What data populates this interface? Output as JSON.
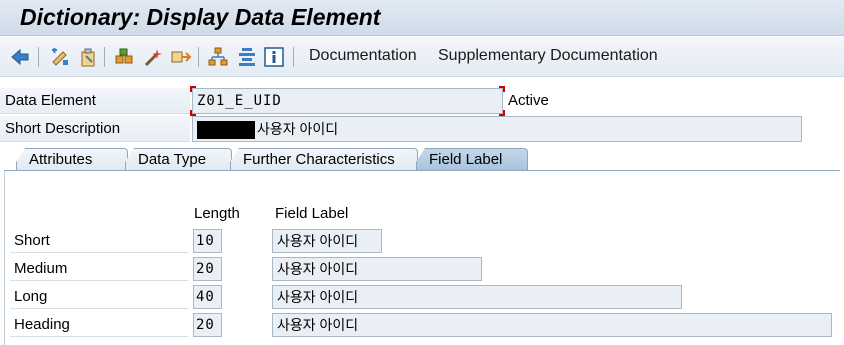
{
  "window": {
    "title": "Dictionary: Display Data Element"
  },
  "toolbar": {
    "icons": [
      "back-arrow-icon",
      "other-object-icon",
      "display-change-icon",
      "check-icon",
      "activate-icon",
      "where-used-icon",
      "object-list-icon",
      "navigation-window-icon",
      "info-icon"
    ],
    "documentation": "Documentation",
    "supplementary_documentation": "Supplementary Documentation"
  },
  "header": {
    "data_element_label": "Data Element",
    "data_element_value": "Z01_E_UID",
    "status": "Active",
    "short_description_label": "Short Description",
    "short_description_value": "사용자 아이디"
  },
  "tabs": [
    {
      "label": "Attributes",
      "active": false
    },
    {
      "label": "Data Type",
      "active": false
    },
    {
      "label": "Further Characteristics",
      "active": false
    },
    {
      "label": "Field Label",
      "active": true
    }
  ],
  "field_label": {
    "length_header": "Length",
    "label_header": "Field Label",
    "rows": [
      {
        "name": "Short",
        "length": "10",
        "label": "사용자 아이디"
      },
      {
        "name": "Medium",
        "length": "20",
        "label": "사용자 아이디"
      },
      {
        "name": "Long",
        "length": "40",
        "label": "사용자 아이디"
      },
      {
        "name": "Heading",
        "length": "20",
        "label": "사용자 아이디"
      }
    ]
  },
  "colors": {
    "active_tab": "#a8c2dc",
    "required_marker": "#cc0000",
    "field_bg": "#e9eff5"
  }
}
